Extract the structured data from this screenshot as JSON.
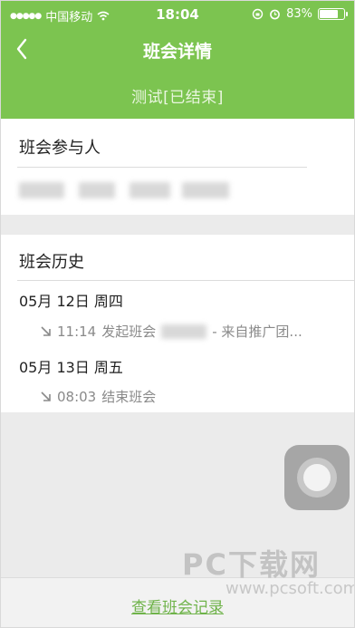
{
  "status_bar": {
    "signal": "●●●●●",
    "carrier": "中国移动",
    "time": "18:04",
    "battery_percent": "83%",
    "battery_level": 0.83
  },
  "nav": {
    "title": "班会详情"
  },
  "subtitle": "测试[已结束]",
  "participants": {
    "title": "班会参与人"
  },
  "history": {
    "title": "班会历史",
    "entries": [
      {
        "date": "05月 12日 周四",
        "event_time": "11:14",
        "event_text": "发起班会",
        "event_suffix": "- 来自推广团..."
      },
      {
        "date": "05月 13日 周五",
        "event_time": "08:03",
        "event_text": "结束班会",
        "event_suffix": ""
      }
    ]
  },
  "bottom": {
    "link": "查看班会记录"
  },
  "watermark": {
    "main": "PC下载网",
    "sub": "www.pcsoft.com.cn"
  },
  "colors": {
    "accent": "#7cc450",
    "link": "#6fb34a"
  }
}
